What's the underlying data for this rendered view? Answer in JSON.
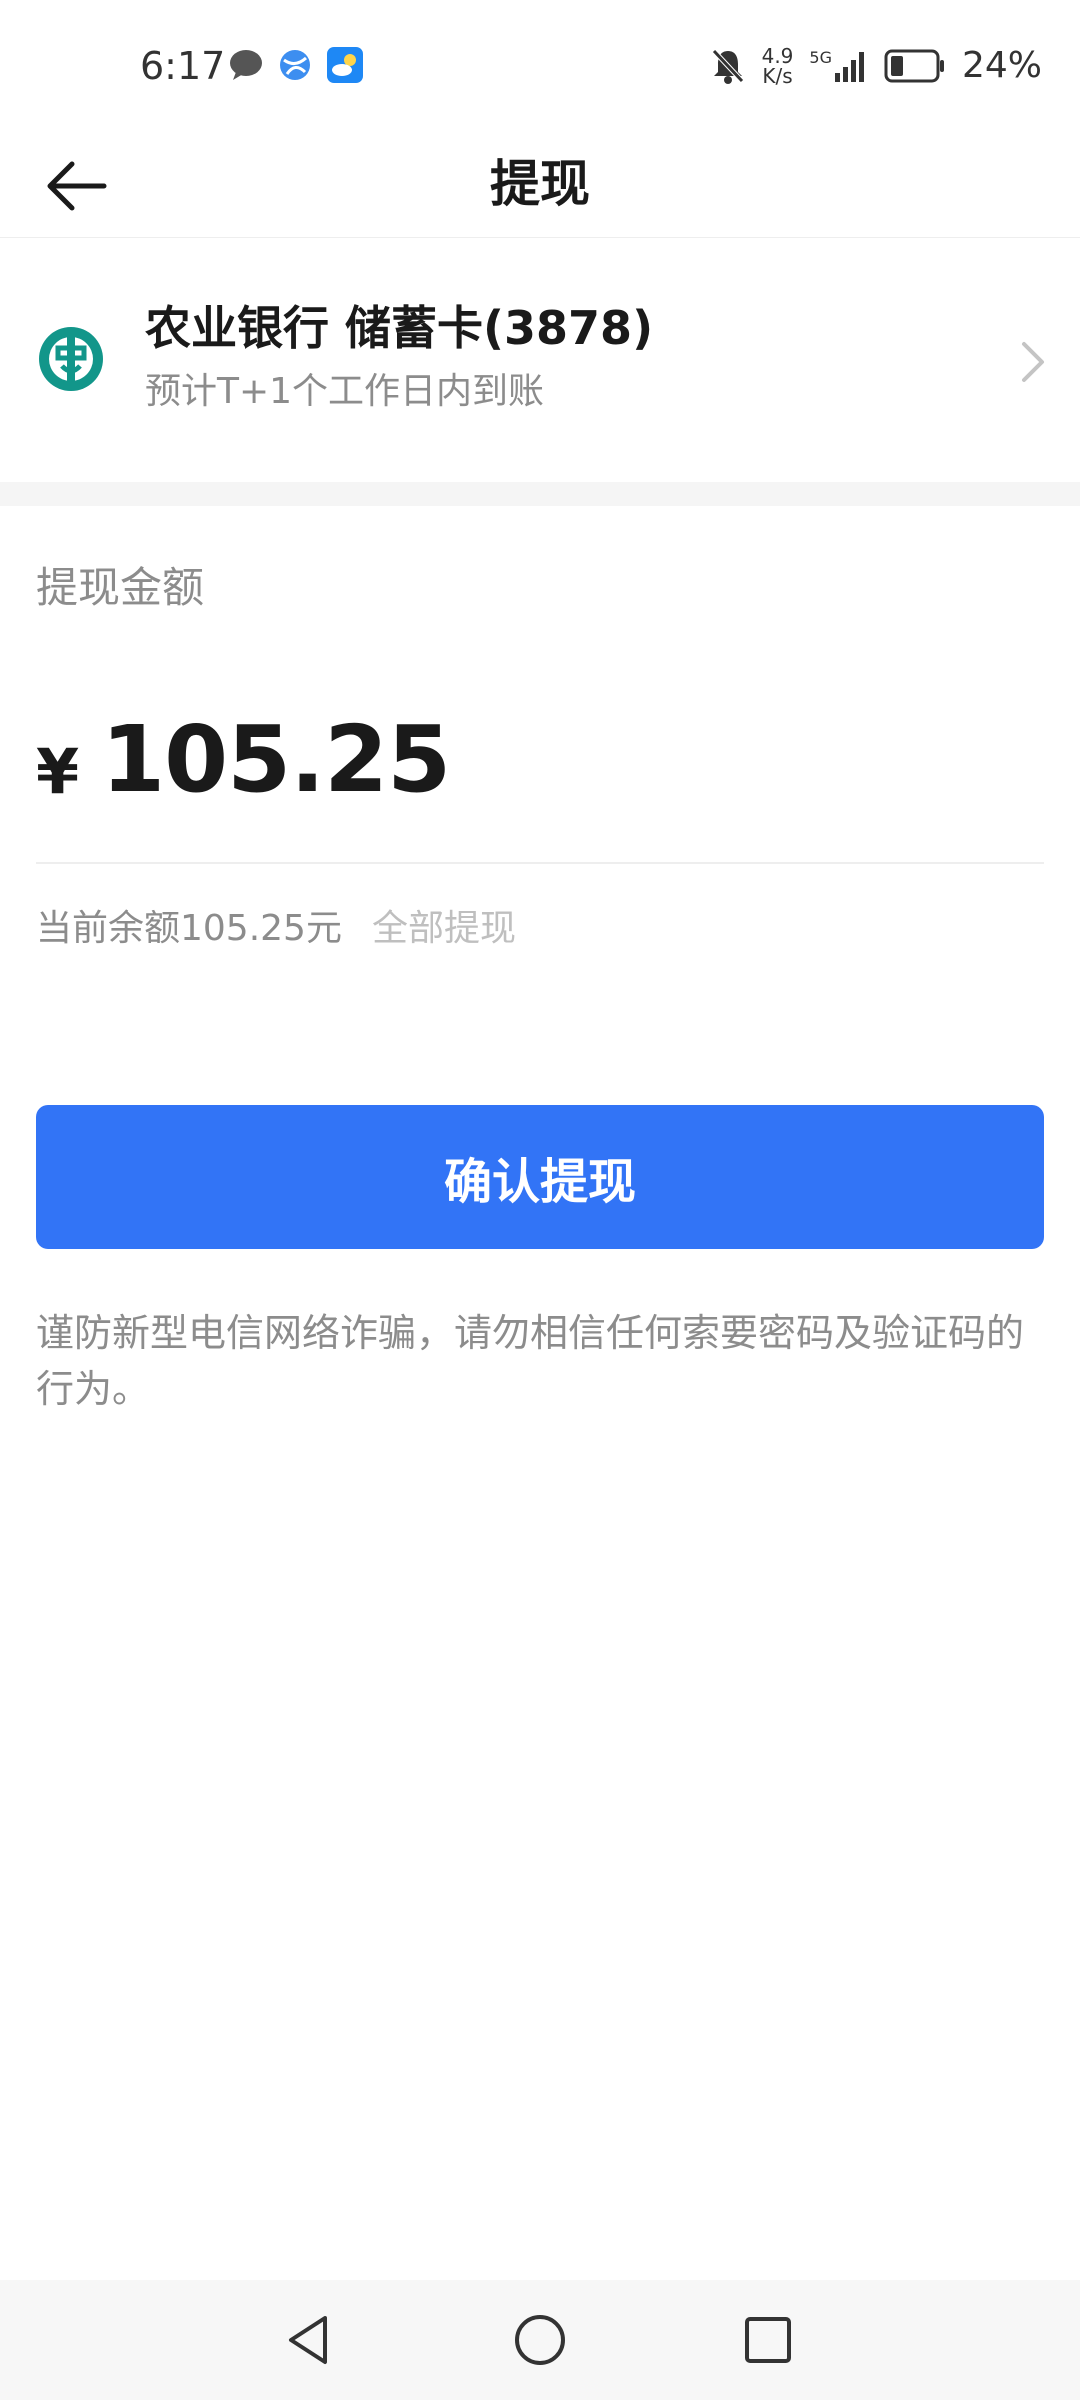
{
  "status_bar": {
    "time": "6:17",
    "net_speed_value": "4.9",
    "net_speed_unit": "K/s",
    "network_type": "5G",
    "battery": "24%",
    "icons": [
      "chat-bubble-icon",
      "browser-icon",
      "weather-icon",
      "mute-bell-icon",
      "signal-icon",
      "battery-icon"
    ]
  },
  "header": {
    "title": "提现"
  },
  "bank": {
    "name": "农业银行 储蓄卡(3878)",
    "arrival": "预计T+1个工作日内到账",
    "logo_color": "#12968a"
  },
  "amount": {
    "label": "提现金额",
    "currency": "¥",
    "value": "105.25",
    "balance_text": "当前余额105.25元",
    "withdraw_all": "全部提现"
  },
  "confirm": {
    "label": "确认提现",
    "color": "#3274f6"
  },
  "warning": "谨防新型电信网络诈骗，请勿相信任何索要密码及验证码的行为。"
}
